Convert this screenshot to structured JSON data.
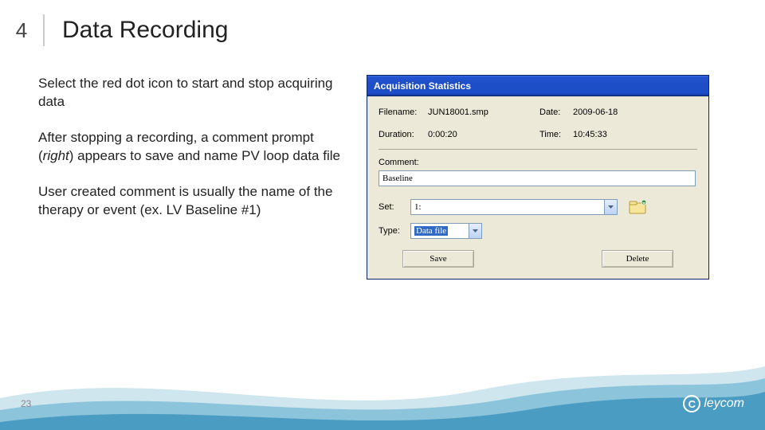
{
  "header": {
    "section_number": "4",
    "title": "Data Recording"
  },
  "left": {
    "p1": "Select the red dot icon to start and stop acquiring data",
    "p2a": "After stopping a recording, a comment prompt (",
    "p2b": "right",
    "p2c": ") appears to save and name PV loop data file",
    "p3": "User created comment is usually the name of the therapy or event (ex. LV Baseline #1)"
  },
  "dialog": {
    "title": "Acquisition Statistics",
    "filename_label": "Filename:",
    "filename_value": "JUN18001.smp",
    "date_label": "Date:",
    "date_value": "2009-06-18",
    "duration_label": "Duration:",
    "duration_value": "0:00:20",
    "time_label": "Time:",
    "time_value": "10:45:33",
    "comment_label": "Comment:",
    "comment_value": "Baseline",
    "set_label": "Set:",
    "set_value": "1:",
    "type_label": "Type:",
    "type_value": "Data file",
    "save_label": "Save",
    "delete_label": "Delete"
  },
  "footer": {
    "page_number": "23",
    "brand": "leycom"
  },
  "colors": {
    "titlebar": "#1d4ec7",
    "dialog_bg": "#ece9d8",
    "wave1": "#6fb9d6",
    "wave2": "#4a9cc2",
    "wave3": "#2f7fa8"
  }
}
